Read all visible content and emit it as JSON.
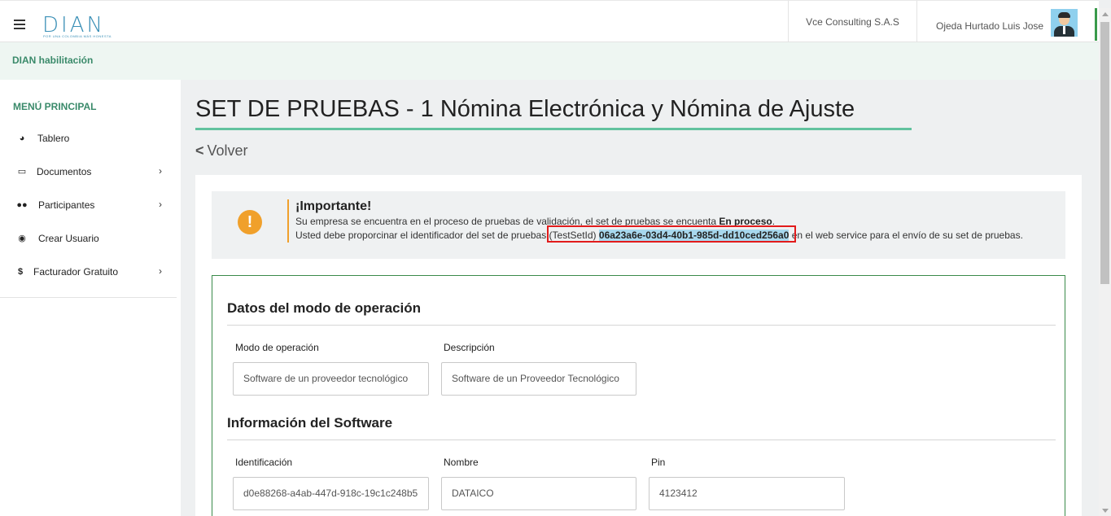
{
  "header": {
    "logo_text": "DIAN",
    "logo_tagline": "POR UNA COLOMBIA MÁS HONESTA",
    "company": "Vce Consulting S.A.S",
    "user_name": "Ojeda Hurtado Luis Jose"
  },
  "subbar": {
    "title": "DIAN habilitación"
  },
  "sidebar": {
    "title": "MENÚ PRINCIPAL",
    "items": [
      {
        "label": "Tablero",
        "icon": "dashboard-icon",
        "has_submenu": false
      },
      {
        "label": "Documentos",
        "icon": "inbox-icon",
        "has_submenu": true
      },
      {
        "label": "Participantes",
        "icon": "users-icon",
        "has_submenu": true
      },
      {
        "label": "Crear Usuario",
        "icon": "user-circle-icon",
        "has_submenu": false
      },
      {
        "label": "Facturador Gratuito",
        "icon": "dollar-icon",
        "has_submenu": true
      }
    ]
  },
  "page": {
    "title": "SET DE PRUEBAS - 1 Nómina Electrónica y Nómina de Ajuste",
    "back_label": "Volver"
  },
  "alert": {
    "title": "¡Importante!",
    "line1_prefix": "Su empresa se encuentra en el proceso de pruebas de validación, el set de pruebas se encuenta ",
    "line1_bold": "En proceso",
    "line1_suffix": ".",
    "line2_prefix": "Usted debe proporcinar el identificador del set de pruebas ",
    "test_set_label": "(TestSetId)",
    "test_set_id": "06a23a6e-03d4-40b1-985d-dd10ced256a0",
    "line2_suffix": " en el web service para el envío de su set de pruebas.",
    "icon": "exclamation-icon"
  },
  "operation_mode": {
    "title": "Datos del modo de operación",
    "fields": [
      {
        "label": "Modo de operación",
        "value": "Software de un proveedor tecnológico"
      },
      {
        "label": "Descripción",
        "value": "Software de un Proveedor Tecnológico"
      }
    ]
  },
  "software_info": {
    "title": "Información del Software",
    "fields": [
      {
        "label": "Identificación",
        "value": "d0e88268-a4ab-447d-918c-19c1c248b5"
      },
      {
        "label": "Nombre",
        "value": "DATAICO"
      },
      {
        "label": "Pin",
        "value": "4123412"
      }
    ]
  },
  "colors": {
    "accent_green": "#62c29e",
    "brand_blue": "#3a8fb6",
    "warning_orange": "#f0a02b",
    "highlight_red": "#e21b1b"
  }
}
